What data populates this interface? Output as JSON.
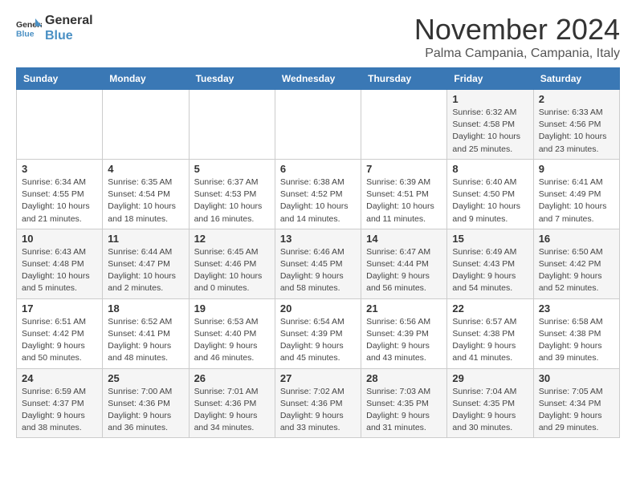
{
  "logo": {
    "line1": "General",
    "line2": "Blue"
  },
  "title": "November 2024",
  "subtitle": "Palma Campania, Campania, Italy",
  "weekdays": [
    "Sunday",
    "Monday",
    "Tuesday",
    "Wednesday",
    "Thursday",
    "Friday",
    "Saturday"
  ],
  "weeks": [
    [
      {
        "day": "",
        "info": ""
      },
      {
        "day": "",
        "info": ""
      },
      {
        "day": "",
        "info": ""
      },
      {
        "day": "",
        "info": ""
      },
      {
        "day": "",
        "info": ""
      },
      {
        "day": "1",
        "info": "Sunrise: 6:32 AM\nSunset: 4:58 PM\nDaylight: 10 hours\nand 25 minutes."
      },
      {
        "day": "2",
        "info": "Sunrise: 6:33 AM\nSunset: 4:56 PM\nDaylight: 10 hours\nand 23 minutes."
      }
    ],
    [
      {
        "day": "3",
        "info": "Sunrise: 6:34 AM\nSunset: 4:55 PM\nDaylight: 10 hours\nand 21 minutes."
      },
      {
        "day": "4",
        "info": "Sunrise: 6:35 AM\nSunset: 4:54 PM\nDaylight: 10 hours\nand 18 minutes."
      },
      {
        "day": "5",
        "info": "Sunrise: 6:37 AM\nSunset: 4:53 PM\nDaylight: 10 hours\nand 16 minutes."
      },
      {
        "day": "6",
        "info": "Sunrise: 6:38 AM\nSunset: 4:52 PM\nDaylight: 10 hours\nand 14 minutes."
      },
      {
        "day": "7",
        "info": "Sunrise: 6:39 AM\nSunset: 4:51 PM\nDaylight: 10 hours\nand 11 minutes."
      },
      {
        "day": "8",
        "info": "Sunrise: 6:40 AM\nSunset: 4:50 PM\nDaylight: 10 hours\nand 9 minutes."
      },
      {
        "day": "9",
        "info": "Sunrise: 6:41 AM\nSunset: 4:49 PM\nDaylight: 10 hours\nand 7 minutes."
      }
    ],
    [
      {
        "day": "10",
        "info": "Sunrise: 6:43 AM\nSunset: 4:48 PM\nDaylight: 10 hours\nand 5 minutes."
      },
      {
        "day": "11",
        "info": "Sunrise: 6:44 AM\nSunset: 4:47 PM\nDaylight: 10 hours\nand 2 minutes."
      },
      {
        "day": "12",
        "info": "Sunrise: 6:45 AM\nSunset: 4:46 PM\nDaylight: 10 hours\nand 0 minutes."
      },
      {
        "day": "13",
        "info": "Sunrise: 6:46 AM\nSunset: 4:45 PM\nDaylight: 9 hours\nand 58 minutes."
      },
      {
        "day": "14",
        "info": "Sunrise: 6:47 AM\nSunset: 4:44 PM\nDaylight: 9 hours\nand 56 minutes."
      },
      {
        "day": "15",
        "info": "Sunrise: 6:49 AM\nSunset: 4:43 PM\nDaylight: 9 hours\nand 54 minutes."
      },
      {
        "day": "16",
        "info": "Sunrise: 6:50 AM\nSunset: 4:42 PM\nDaylight: 9 hours\nand 52 minutes."
      }
    ],
    [
      {
        "day": "17",
        "info": "Sunrise: 6:51 AM\nSunset: 4:42 PM\nDaylight: 9 hours\nand 50 minutes."
      },
      {
        "day": "18",
        "info": "Sunrise: 6:52 AM\nSunset: 4:41 PM\nDaylight: 9 hours\nand 48 minutes."
      },
      {
        "day": "19",
        "info": "Sunrise: 6:53 AM\nSunset: 4:40 PM\nDaylight: 9 hours\nand 46 minutes."
      },
      {
        "day": "20",
        "info": "Sunrise: 6:54 AM\nSunset: 4:39 PM\nDaylight: 9 hours\nand 45 minutes."
      },
      {
        "day": "21",
        "info": "Sunrise: 6:56 AM\nSunset: 4:39 PM\nDaylight: 9 hours\nand 43 minutes."
      },
      {
        "day": "22",
        "info": "Sunrise: 6:57 AM\nSunset: 4:38 PM\nDaylight: 9 hours\nand 41 minutes."
      },
      {
        "day": "23",
        "info": "Sunrise: 6:58 AM\nSunset: 4:38 PM\nDaylight: 9 hours\nand 39 minutes."
      }
    ],
    [
      {
        "day": "24",
        "info": "Sunrise: 6:59 AM\nSunset: 4:37 PM\nDaylight: 9 hours\nand 38 minutes."
      },
      {
        "day": "25",
        "info": "Sunrise: 7:00 AM\nSunset: 4:36 PM\nDaylight: 9 hours\nand 36 minutes."
      },
      {
        "day": "26",
        "info": "Sunrise: 7:01 AM\nSunset: 4:36 PM\nDaylight: 9 hours\nand 34 minutes."
      },
      {
        "day": "27",
        "info": "Sunrise: 7:02 AM\nSunset: 4:36 PM\nDaylight: 9 hours\nand 33 minutes."
      },
      {
        "day": "28",
        "info": "Sunrise: 7:03 AM\nSunset: 4:35 PM\nDaylight: 9 hours\nand 31 minutes."
      },
      {
        "day": "29",
        "info": "Sunrise: 7:04 AM\nSunset: 4:35 PM\nDaylight: 9 hours\nand 30 minutes."
      },
      {
        "day": "30",
        "info": "Sunrise: 7:05 AM\nSunset: 4:34 PM\nDaylight: 9 hours\nand 29 minutes."
      }
    ]
  ]
}
